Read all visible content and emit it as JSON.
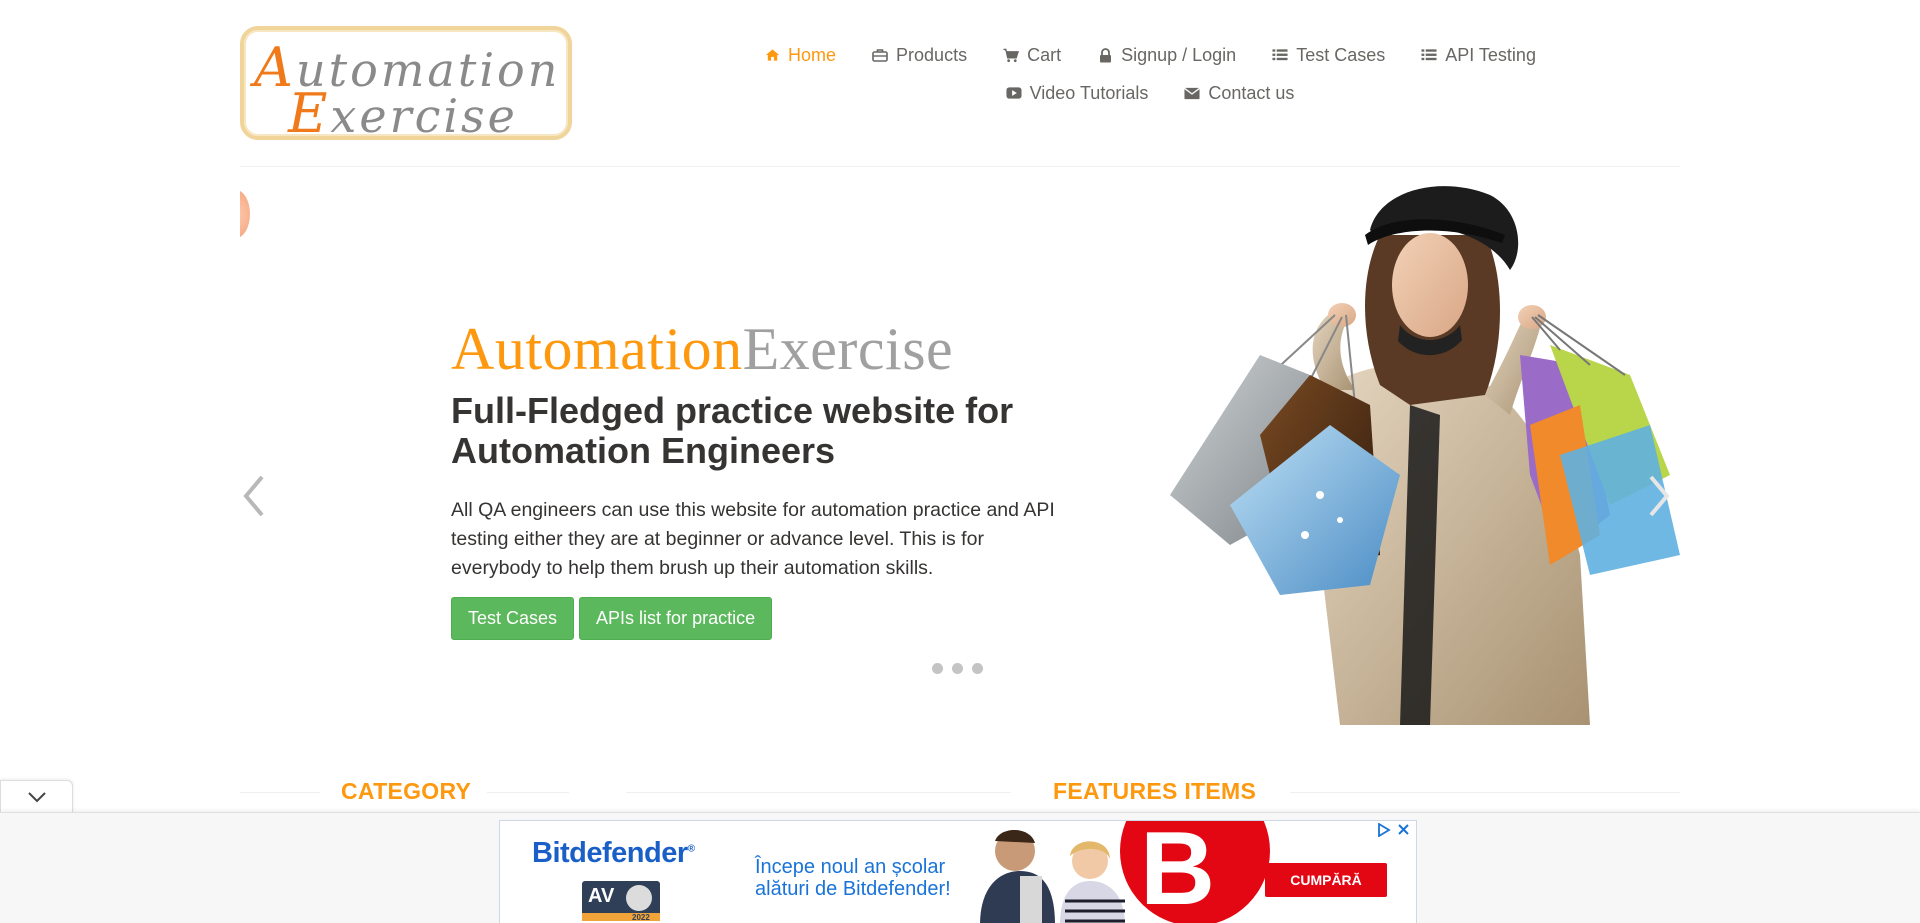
{
  "logo": {
    "line1_cap": "A",
    "line1_rest": "utomation",
    "line2_cap": "E",
    "line2_rest": "xercise"
  },
  "nav": {
    "items": [
      {
        "label": "Home",
        "icon": "home-icon",
        "active": true
      },
      {
        "label": "Products",
        "icon": "briefcase-icon"
      },
      {
        "label": "Cart",
        "icon": "cart-icon"
      },
      {
        "label": "Signup / Login",
        "icon": "lock-icon"
      },
      {
        "label": "Test Cases",
        "icon": "list-icon"
      },
      {
        "label": "API Testing",
        "icon": "list-icon"
      },
      {
        "label": "Video Tutorials",
        "icon": "youtube-play-icon"
      },
      {
        "label": "Contact us",
        "icon": "envelope-icon"
      }
    ]
  },
  "slider": {
    "brand_a": "Automation",
    "brand_b": "Exercise",
    "headline": "Full-Fledged practice website for Automation Engineers",
    "description": "All QA engineers can use this website for automation practice and API testing either they are at beginner or advance level. This is for everybody to help them brush up their automation skills.",
    "buttons": [
      "Test Cases",
      "APIs list for practice"
    ],
    "prev_icon": "chevron-left-icon",
    "next_icon": "chevron-right-icon",
    "indicator_count": 3
  },
  "sections": {
    "category": "CATEGORY",
    "features": "FEATURES ITEMS"
  },
  "ad": {
    "brand": "Bitdefender",
    "badge": "AV",
    "badge_year": "2022",
    "text_line1": "Începe noul an școlar",
    "text_line2": "alături de Bitdefender!",
    "letter": "B",
    "cta": "CUMPĂRĂ",
    "adchoices_icon": "adchoices-icon",
    "close_icon": "close-icon"
  },
  "colors": {
    "accent": "#fe980f",
    "button_green": "#5cb85c",
    "ad_red": "#e30613",
    "ad_blue": "#1a5fc8"
  }
}
